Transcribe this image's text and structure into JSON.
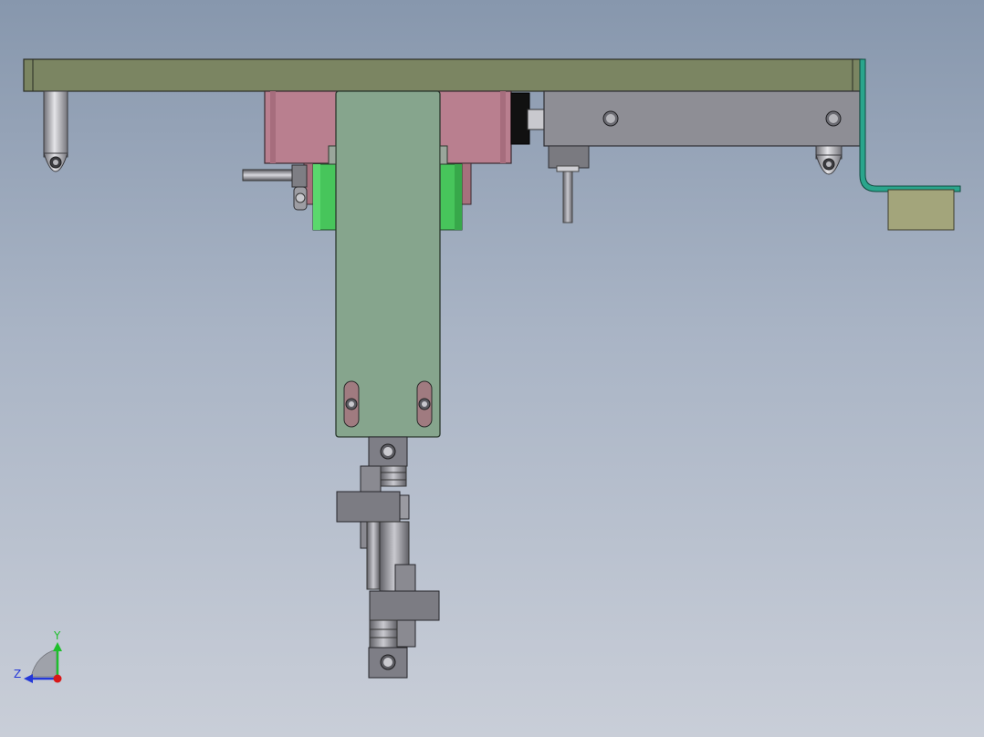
{
  "viewport": {
    "background_top": "#8797ad",
    "background_bottom": "#c9ced8"
  },
  "colors": {
    "base_plate": "#7b8562",
    "pink_block": "#b97f8f",
    "green_arm": "#86a58d",
    "bright_green": "#47c55b",
    "metal": "#8e8e95",
    "teal_bracket": "#2aa58c",
    "tan_block": "#a3a57b"
  },
  "triad": {
    "y_label": "Y",
    "z_label": "Z",
    "y_color": "#1fbf2c",
    "z_color": "#2438d8",
    "origin_color": "#d81818"
  }
}
